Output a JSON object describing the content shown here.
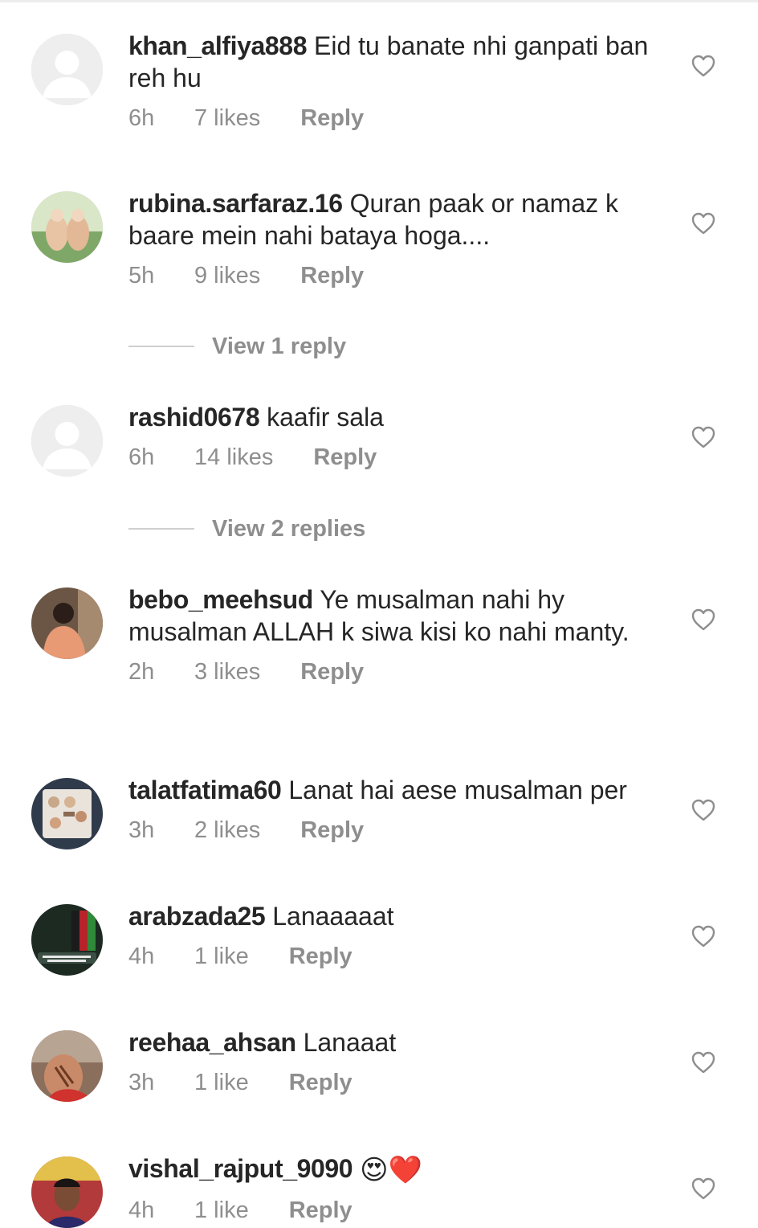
{
  "comments": [
    {
      "username": "khan_alfiya888",
      "text": "Eid tu banate nhi ganpati ban reh hu",
      "time": "6h",
      "likes": "7 likes",
      "reply": "Reply",
      "avatar": "default-avatar"
    },
    {
      "username": "rubina.sarfaraz.16",
      "text": "Quran paak or namaz k baare mein nahi bataya hoga....",
      "time": "5h",
      "likes": "9 likes",
      "reply": "Reply",
      "avatar": "photo-avatar"
    },
    {
      "username": "rashid0678",
      "text": "kaafir sala",
      "time": "6h",
      "likes": "14 likes",
      "reply": "Reply",
      "avatar": "default-avatar"
    },
    {
      "username": "bebo_meehsud",
      "text": "Ye musalman nahi hy musalman ALLAH k siwa kisi ko nahi manty.",
      "time": "2h",
      "likes": "3 likes",
      "reply": "Reply",
      "avatar": "photo-avatar"
    },
    {
      "username": "talatfatima60",
      "text": "Lanat hai aese musalman per",
      "time": "3h",
      "likes": "2 likes",
      "reply": "Reply",
      "avatar": "photo-avatar"
    },
    {
      "username": "arabzada25",
      "text": "Lanaaaaat",
      "time": "4h",
      "likes": "1 like",
      "reply": "Reply",
      "avatar": "photo-avatar"
    },
    {
      "username": "reehaa_ahsan",
      "text": "Lanaaat",
      "time": "3h",
      "likes": "1 like",
      "reply": "Reply",
      "avatar": "photo-avatar"
    },
    {
      "username": "vishal_rajput_9090",
      "text": "😍❤️",
      "time": "4h",
      "likes": "1 like",
      "reply": "Reply",
      "avatar": "photo-avatar"
    }
  ],
  "view_replies": [
    {
      "label": "View 1 reply"
    },
    {
      "label": "View 2 replies"
    }
  ],
  "colors": {
    "text": "#262626",
    "muted": "#8e8e8e",
    "divider": "#cfcfcf",
    "avatar_placeholder": "#eeeeee"
  }
}
